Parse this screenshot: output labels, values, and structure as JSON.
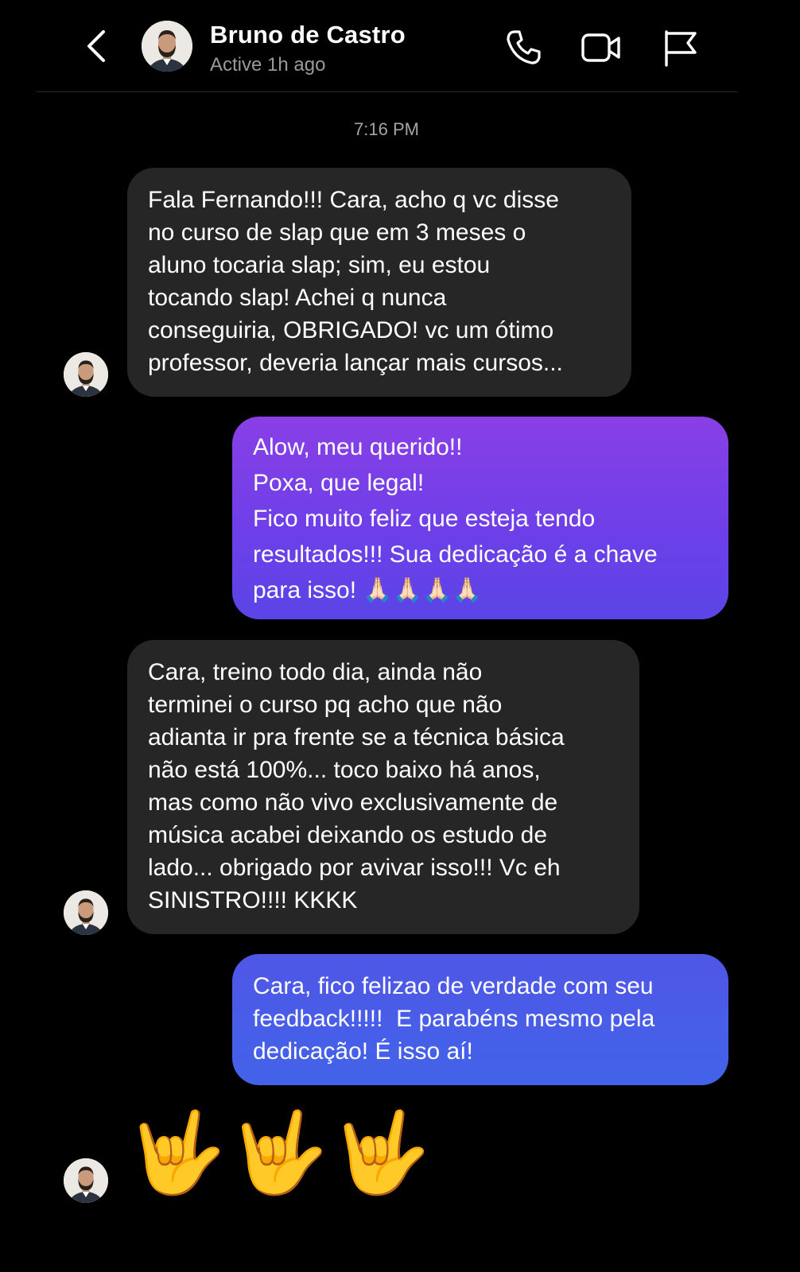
{
  "header": {
    "name": "Bruno de Castro",
    "status": "Active 1h ago",
    "icons": [
      "back-chevron-icon",
      "phone-icon",
      "video-camera-icon",
      "flag-icon"
    ]
  },
  "timestamp": "7:16 PM",
  "messages": [
    {
      "from": "contact",
      "text": "Fala Fernando!!! Cara, acho q vc disse\nno curso de slap que em 3 meses o\naluno tocaria slap; sim, eu estou\ntocando slap! Achei q nunca\nconseguiria, OBRIGADO! vc um ótimo\nprofessor, deveria lançar mais cursos..."
    },
    {
      "from": "me",
      "text": "Alow, meu querido!!\nPoxa, que legal!\nFico muito feliz que esteja tendo\nresultados!!! Sua dedicação é a chave\npara isso! 🙏🏻🙏🏻🙏🏻🙏🏻"
    },
    {
      "from": "contact",
      "text": "Cara, treino todo dia, ainda não\nterminei o curso pq acho que não\nadianta ir pra frente se a técnica básica\nnão está 100%... toco baixo há anos,\nmas como não vivo exclusivamente de\nmúsica acabei deixando os estudo de\nlado... obrigado por avivar isso!!! Vc eh\nSINISTRO!!!! KKKK"
    },
    {
      "from": "me",
      "text": "Cara, fico felizao de verdade com seu\nfeedback!!!!!  E parabéns mesmo pela\ndedicação! É isso aí!"
    },
    {
      "from": "contact",
      "text": "🤟🤟🤟"
    }
  ],
  "colors": {
    "incoming_bubble": "#262626",
    "outgoing_bubble_top": "#8a3fe6",
    "outgoing_bubble_bottom": "#4263e9",
    "background": "#000000"
  }
}
